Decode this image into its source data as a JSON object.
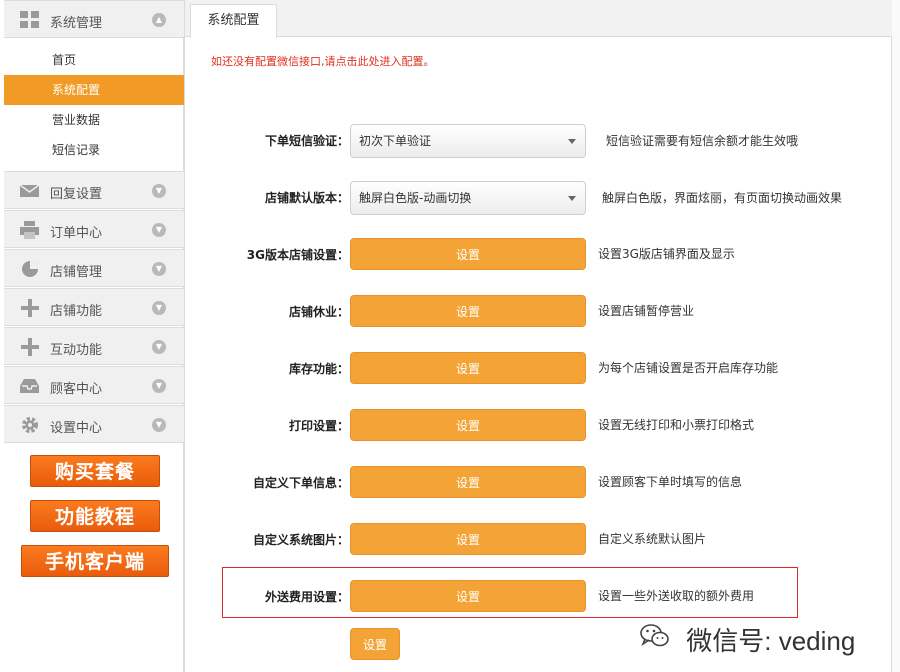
{
  "sidebar": {
    "top_menu": {
      "label": "系统管理",
      "icon": "grid-icon"
    },
    "sub_items": [
      {
        "label": "首页"
      },
      {
        "label": "系统配置"
      },
      {
        "label": "营业数据"
      },
      {
        "label": "短信记录"
      }
    ],
    "menus": [
      {
        "label": "回复设置",
        "icon": "envelope-icon"
      },
      {
        "label": "订单中心",
        "icon": "printer-icon"
      },
      {
        "label": "店铺管理",
        "icon": "pie-chart-icon"
      },
      {
        "label": "店铺功能",
        "icon": "plus-icon"
      },
      {
        "label": "互动功能",
        "icon": "plus-icon"
      },
      {
        "label": "顾客中心",
        "icon": "inbox-icon"
      },
      {
        "label": "设置中心",
        "icon": "gear-icon"
      }
    ],
    "buttons": {
      "buy": "购买套餐",
      "tutorial": "功能教程",
      "mobile": "手机客户端"
    },
    "active_color": "#f29a26"
  },
  "main": {
    "tab": "系统配置",
    "notice": "如还没有配置微信接口,请点击此处进入配置。",
    "rows": [
      {
        "label": "下单短信验证：",
        "control": "select",
        "value": "初次下单验证",
        "desc": "短信验证需要有短信余额才能生效哦"
      },
      {
        "label": "店铺默认版本：",
        "control": "select",
        "value": "触屏白色版-动画切换",
        "desc": "触屏白色版，界面炫丽，有页面切换动画效果"
      },
      {
        "label": "3G版本店铺设置：",
        "control": "button",
        "value": "设置",
        "desc": "设置3G版店铺界面及显示"
      },
      {
        "label": "店铺休业：",
        "control": "button",
        "value": "设置",
        "desc": "设置店铺暂停营业"
      },
      {
        "label": "库存功能：",
        "control": "button",
        "value": "设置",
        "desc": "为每个店铺设置是否开启库存功能"
      },
      {
        "label": "打印设置：",
        "control": "button",
        "value": "设置",
        "desc": "设置无线打印和小票打印格式"
      },
      {
        "label": "自定义下单信息：",
        "control": "button",
        "value": "设置",
        "desc": "设置顾客下单时填写的信息"
      },
      {
        "label": "自定义系统图片：",
        "control": "button",
        "value": "设置",
        "desc": "自定义系统默认图片"
      },
      {
        "label": "外送费用设置：",
        "control": "button",
        "value": "设置",
        "desc": "设置一些外送收取的额外费用"
      }
    ],
    "save_label": "设置",
    "accent_color": "#f4a437",
    "notice_color": "#e0301e"
  },
  "watermark": {
    "text": "微信号: veding",
    "icon": "wechat-icon"
  }
}
